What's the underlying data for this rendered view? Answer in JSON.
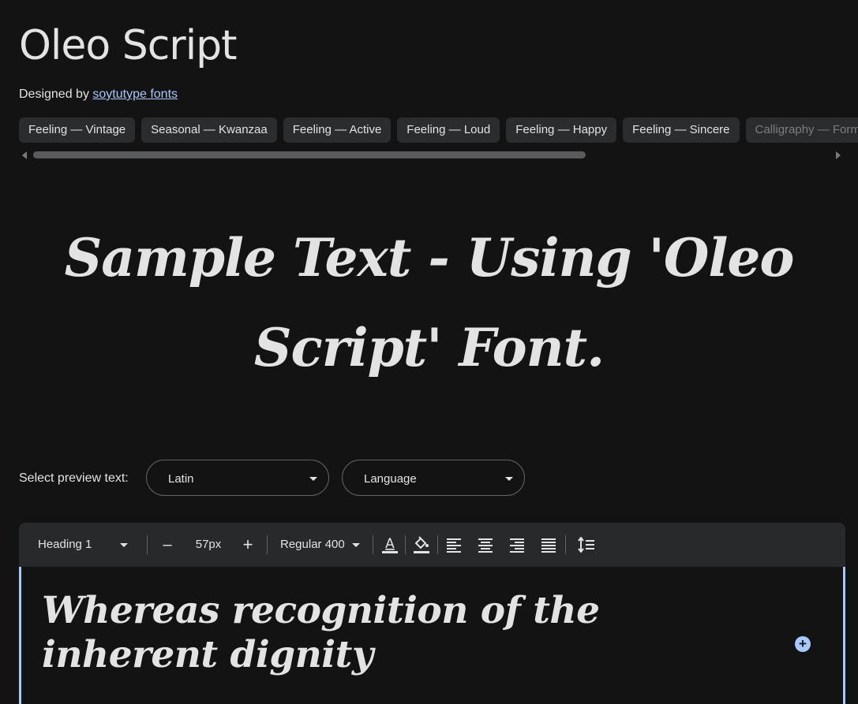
{
  "header": {
    "title": "Oleo Script",
    "designed_by_label": "Designed by",
    "designer_name": "soytutype fonts"
  },
  "tags": [
    "Feeling — Vintage",
    "Seasonal — Kwanzaa",
    "Feeling — Active",
    "Feeling — Loud",
    "Feeling — Happy",
    "Feeling — Sincere",
    "Calligraphy — Formal"
  ],
  "sample_text": "Sample Text - Using 'Oleo Script' Font.",
  "preview": {
    "label": "Select preview text:",
    "script_value": "Latin",
    "language_value": "Language"
  },
  "toolbar": {
    "style_value": "Heading 1",
    "decrease_label": "–",
    "size_value": "57px",
    "increase_label": "+",
    "weight_value": "Regular 400"
  },
  "editor": {
    "text": "Whereas recognition of the inherent dignity",
    "add_label": "+"
  },
  "colors": {
    "background": "#131314",
    "accent": "#a8c7fa",
    "chip": "#2b2c2e",
    "toolbar": "#28292b"
  }
}
